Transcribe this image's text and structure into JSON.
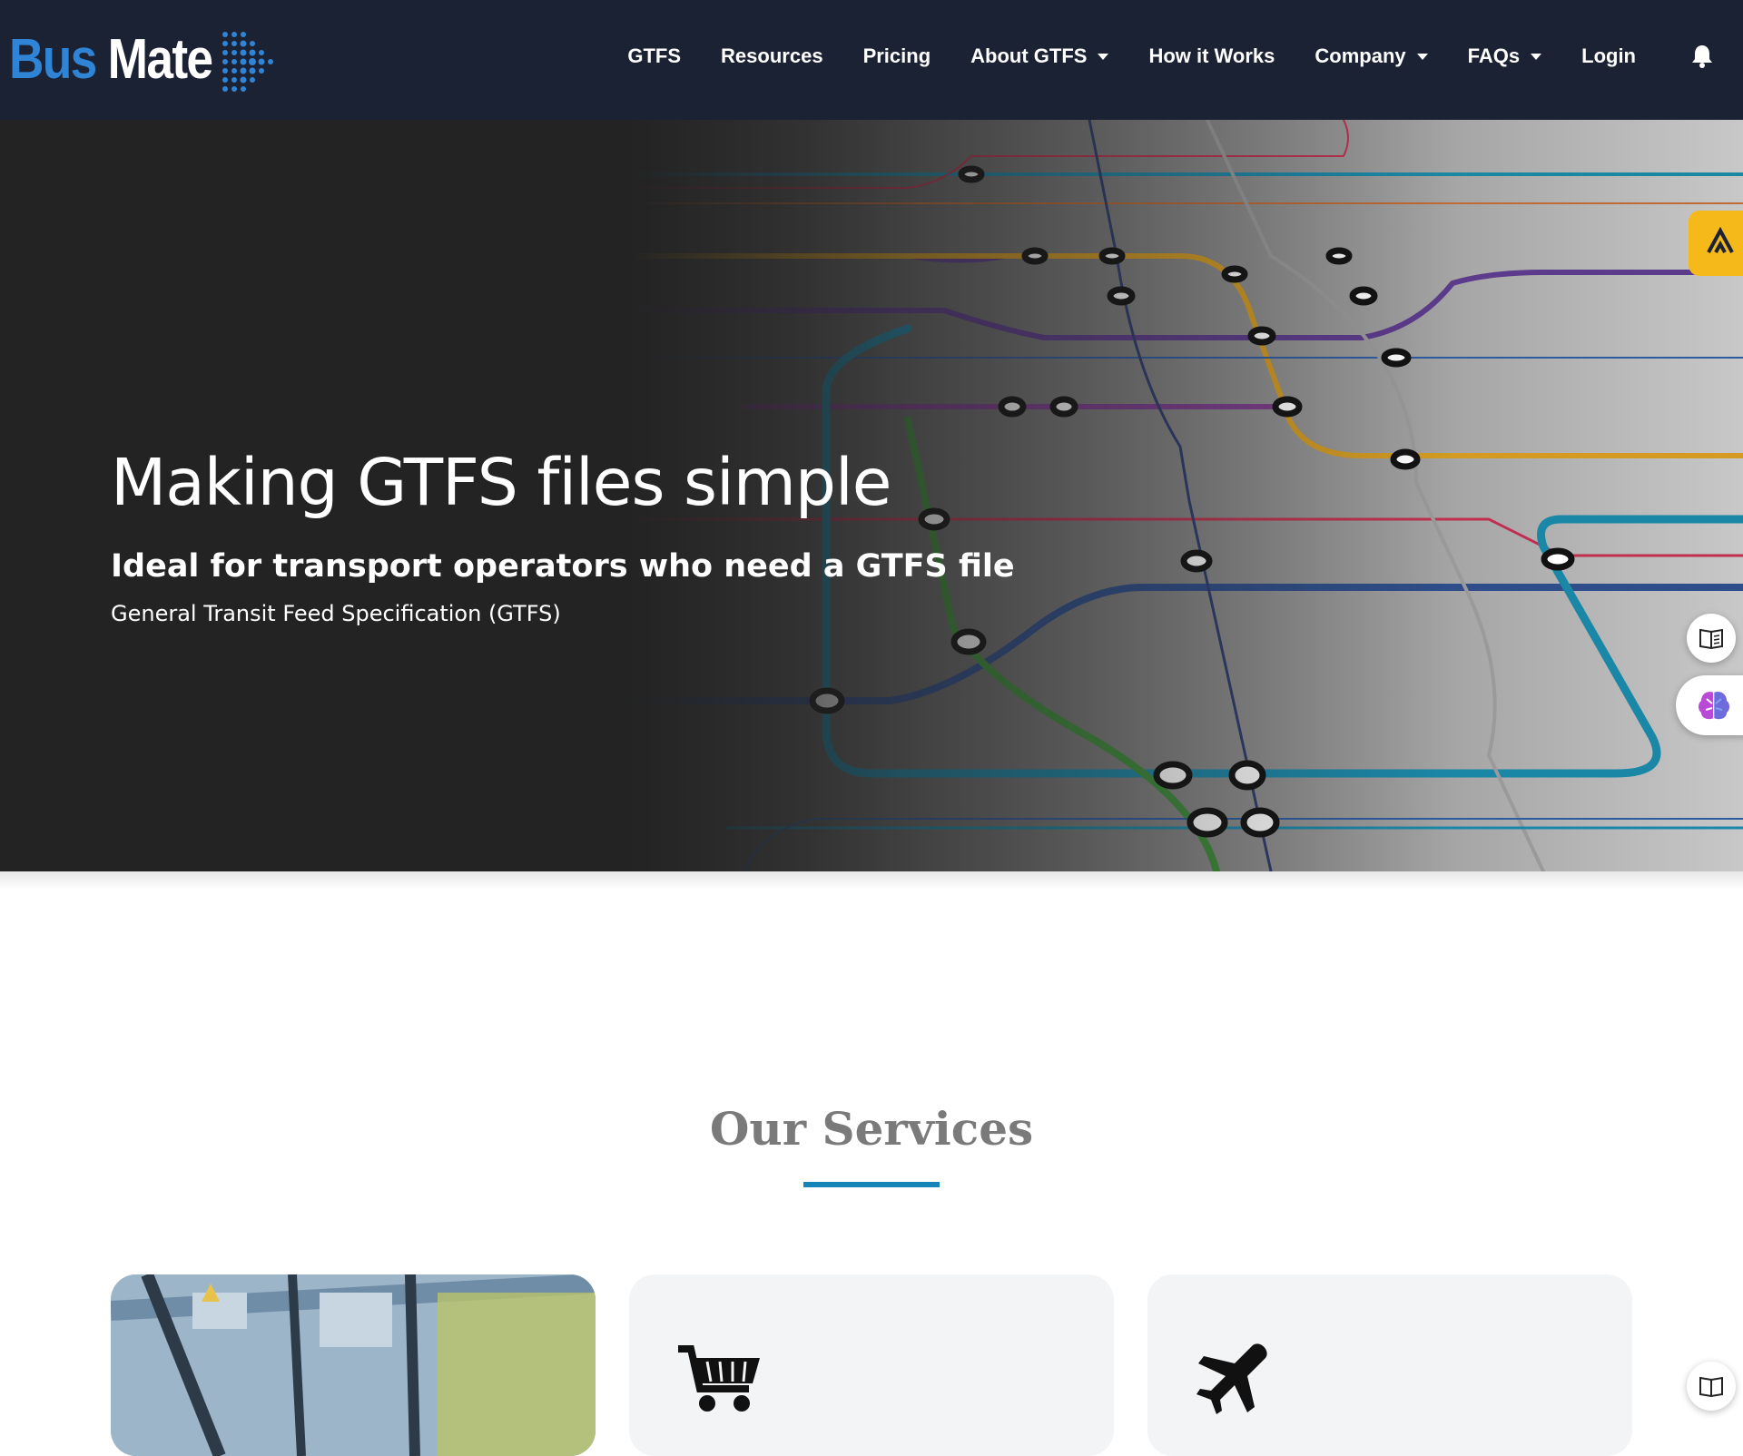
{
  "brand": {
    "part1": "Bus",
    "part2": "Mate"
  },
  "nav": {
    "items": [
      {
        "label": "GTFS",
        "dropdown": false
      },
      {
        "label": "Resources",
        "dropdown": false
      },
      {
        "label": "Pricing",
        "dropdown": false
      },
      {
        "label": "About GTFS",
        "dropdown": true
      },
      {
        "label": "How it Works",
        "dropdown": false
      },
      {
        "label": "Company",
        "dropdown": true
      },
      {
        "label": "FAQs",
        "dropdown": true
      },
      {
        "label": "Login",
        "dropdown": false
      }
    ]
  },
  "hero": {
    "title": "Making GTFS files simple",
    "subtitle": "Ideal for transport operators who need a GTFS file",
    "tagline": "General Transit Feed Specification (GTFS)"
  },
  "services": {
    "heading": "Our Services",
    "cards": [
      {
        "icon": "map-image"
      },
      {
        "icon": "shopping-cart-icon"
      },
      {
        "icon": "airplane-icon"
      }
    ]
  },
  "colors": {
    "navbar": "#1b2233",
    "brand_blue": "#2f84d6",
    "accent_underline": "#1582b8",
    "side_tab": "#f5b91a"
  }
}
